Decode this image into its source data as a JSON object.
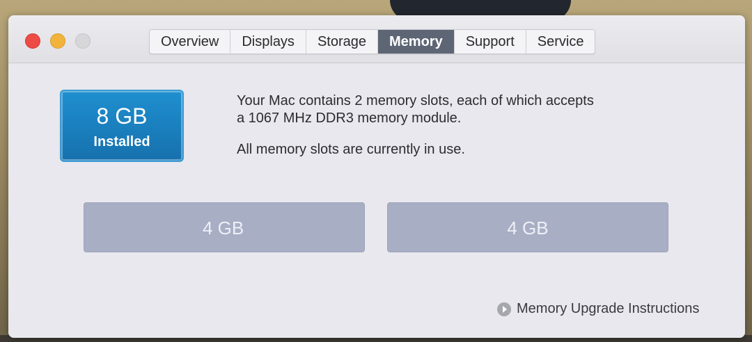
{
  "tabs": [
    {
      "label": "Overview"
    },
    {
      "label": "Displays"
    },
    {
      "label": "Storage"
    },
    {
      "label": "Memory"
    },
    {
      "label": "Support"
    },
    {
      "label": "Service"
    }
  ],
  "active_tab": "Memory",
  "installed": {
    "size": "8 GB",
    "label": "Installed"
  },
  "description": {
    "line1": "Your Mac contains 2 memory slots, each of which accepts",
    "line2": "a 1067 MHz DDR3 memory module.",
    "note": "All memory slots are currently in use."
  },
  "slots": [
    {
      "size": "4 GB"
    },
    {
      "size": "4 GB"
    }
  ],
  "upgrade_link": "Memory Upgrade Instructions",
  "colors": {
    "accent": "#1f8fd0",
    "close": "#ec4b46",
    "minimize": "#f2b33c",
    "slot": "#a8aec4",
    "active_tab": "#5e6675"
  },
  "icons": {
    "upgrade": "arrow-circle-icon"
  }
}
